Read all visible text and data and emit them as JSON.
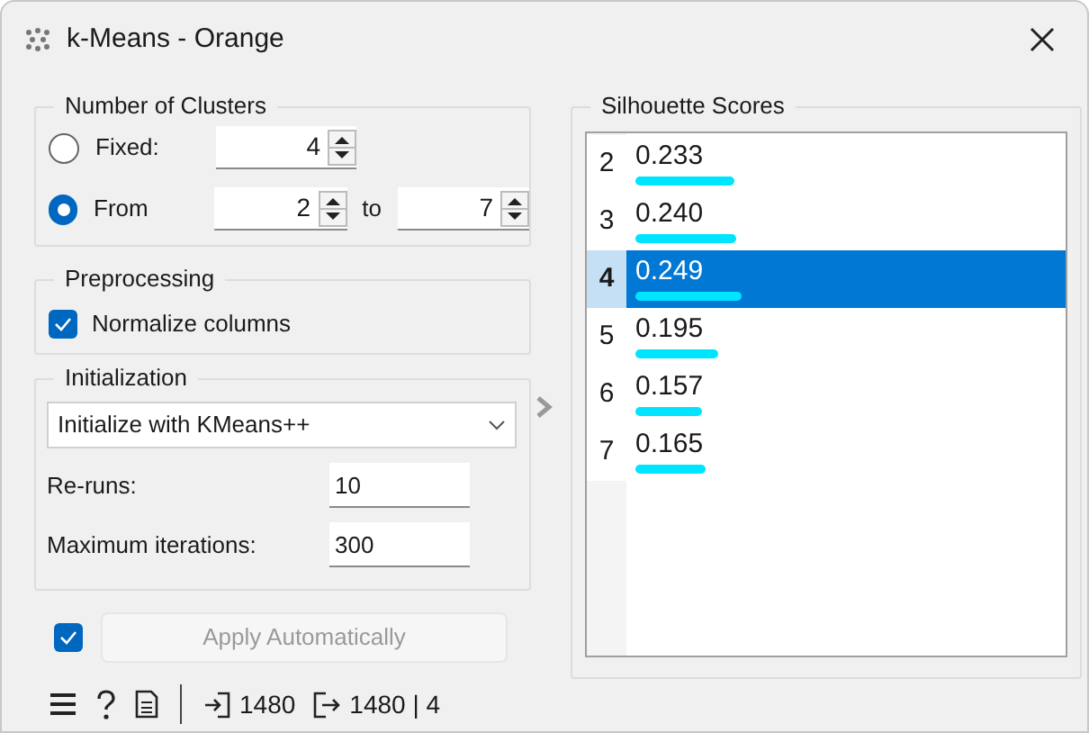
{
  "window": {
    "title": "k-Means - Orange"
  },
  "clusters": {
    "title": "Number of Clusters",
    "options": [
      {
        "kind": "single",
        "label": "Fixed:",
        "selected": false,
        "value": "4"
      },
      {
        "kind": "range",
        "label": "From",
        "selected": true,
        "value": "2",
        "to_label": "to",
        "to_value": "7"
      }
    ]
  },
  "preprocessing": {
    "title": "Preprocessing",
    "normalize": {
      "label": "Normalize columns",
      "checked": true
    }
  },
  "initialization": {
    "title": "Initialization",
    "method": "Initialize with KMeans++",
    "fields": [
      {
        "label": "Re-runs:",
        "value": "10"
      },
      {
        "label": "Maximum iterations:",
        "value": "300"
      }
    ]
  },
  "apply": {
    "auto_checked": true,
    "label": "Apply Automatically"
  },
  "status_bar": {
    "input_count": "1480",
    "output_count": "1480 | 4"
  },
  "silhouette": {
    "title": "Silhouette Scores",
    "rows": [
      {
        "k": "2",
        "score": "0.233",
        "level": 0.233,
        "selected": false
      },
      {
        "k": "3",
        "score": "0.240",
        "level": 0.24,
        "selected": false
      },
      {
        "k": "4",
        "score": "0.249",
        "level": 0.249,
        "selected": true
      },
      {
        "k": "5",
        "score": "0.195",
        "level": 0.195,
        "selected": false
      },
      {
        "k": "6",
        "score": "0.157",
        "level": 0.157,
        "selected": false
      },
      {
        "k": "7",
        "score": "0.165",
        "level": 0.165,
        "selected": false
      }
    ]
  }
}
